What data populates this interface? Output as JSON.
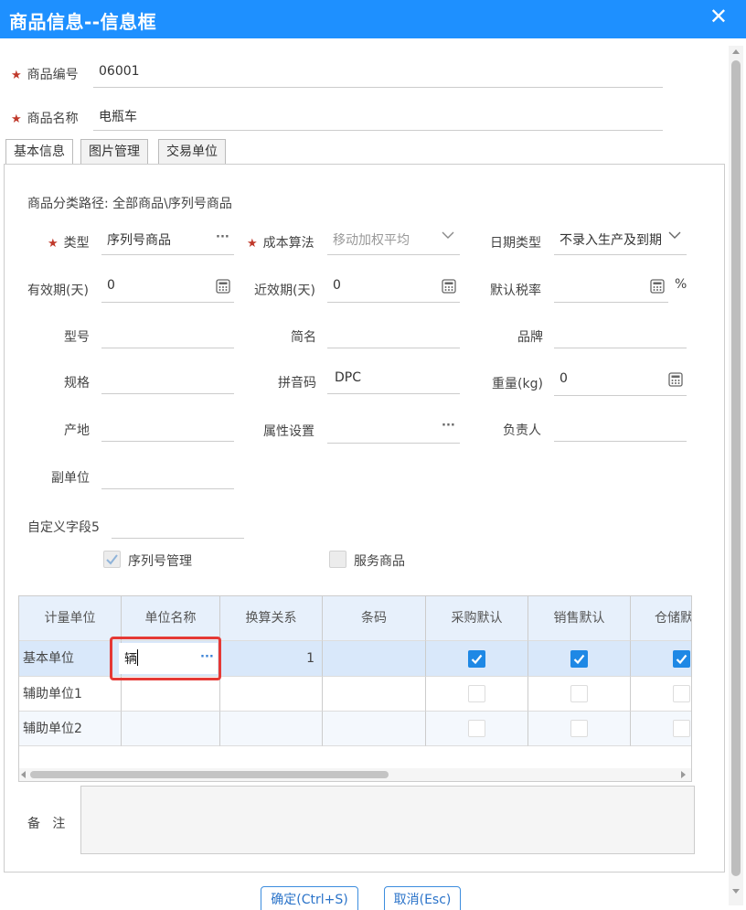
{
  "window": {
    "title": "商品信息--信息框",
    "close_glyph": "✕"
  },
  "header_fields": {
    "code": {
      "label": "商品编号",
      "value": "06001"
    },
    "name": {
      "label": "商品名称",
      "value": "电瓶车"
    }
  },
  "tabs": [
    {
      "label": "基本信息",
      "active": true
    },
    {
      "label": "图片管理",
      "active": false
    },
    {
      "label": "交易单位",
      "active": false
    }
  ],
  "basic": {
    "category_path": "商品分类路径:  全部商品\\序列号商品",
    "type": {
      "label": "类型",
      "value": "序列号商品"
    },
    "cost_method": {
      "label": "成本算法",
      "value": "移动加权平均"
    },
    "date_type": {
      "label": "日期类型",
      "value": "不录入生产及到期"
    },
    "validity_days": {
      "label": "有效期(天)",
      "value": "0"
    },
    "near_validity_days": {
      "label": "近效期(天)",
      "value": "0"
    },
    "default_tax": {
      "label": "默认税率",
      "value": "",
      "suffix": "%"
    },
    "model": {
      "label": "型号",
      "value": ""
    },
    "short_name": {
      "label": "简名",
      "value": ""
    },
    "brand": {
      "label": "品牌",
      "value": ""
    },
    "spec": {
      "label": "规格",
      "value": ""
    },
    "pinyin": {
      "label": "拼音码",
      "value": "DPC"
    },
    "weight": {
      "label": "重量(kg)",
      "value": "0"
    },
    "origin": {
      "label": "产地",
      "value": ""
    },
    "attr_setting": {
      "label": "属性设置",
      "value": ""
    },
    "owner": {
      "label": "负责人",
      "value": ""
    },
    "sub_unit": {
      "label": "副单位",
      "value": ""
    },
    "custom5": {
      "label": "自定义字段5",
      "value": ""
    },
    "serial_mgmt": {
      "label": "序列号管理",
      "checked": true
    },
    "service_goods": {
      "label": "服务商品",
      "checked": false
    }
  },
  "unit_table": {
    "headers": [
      "计量单位",
      "单位名称",
      "换算关系",
      "条码",
      "采购默认",
      "销售默认",
      "仓储默认"
    ],
    "rows": [
      {
        "unit": "基本单位",
        "name": "辆",
        "ratio": "1",
        "barcode": "",
        "purchase": true,
        "sale": true,
        "storage": true
      },
      {
        "unit": "辅助单位1",
        "name": "",
        "ratio": "",
        "barcode": "",
        "purchase": false,
        "sale": false,
        "storage": false
      },
      {
        "unit": "辅助单位2",
        "name": "",
        "ratio": "",
        "barcode": "",
        "purchase": false,
        "sale": false,
        "storage": false
      }
    ]
  },
  "remark": {
    "label": "备   注",
    "value": ""
  },
  "buttons": {
    "ok": "确定(Ctrl+S)",
    "cancel": "取消(Esc)"
  },
  "icons": {
    "ellipsis": "···",
    "chevron": "chevron-down-icon",
    "calc": "calculator-icon",
    "check": "check-icon"
  },
  "colors": {
    "title_bar": "#1e90ff",
    "required": "#c0392b",
    "check_on": "#1e88e5",
    "highlight": "#e53935"
  }
}
